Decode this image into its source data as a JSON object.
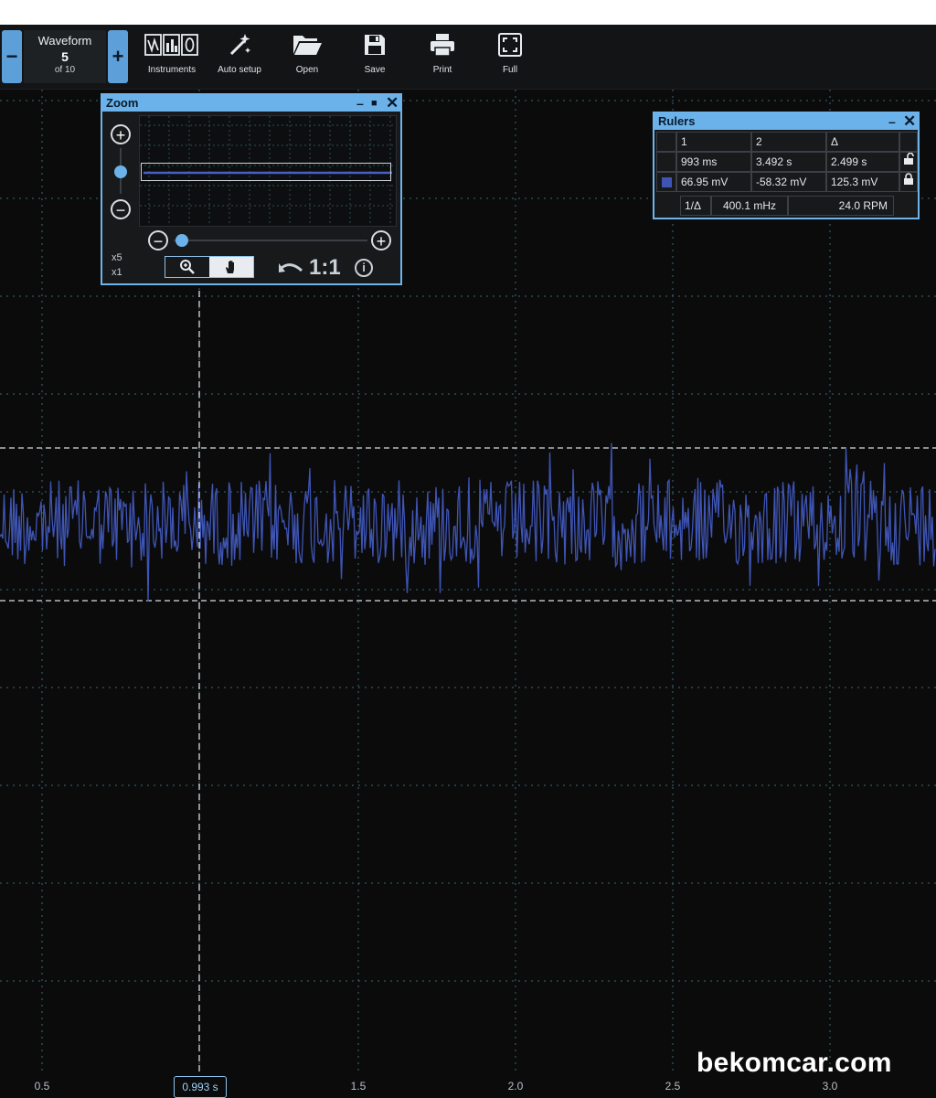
{
  "toolbar": {
    "waveform": {
      "title": "Waveform",
      "current": "5",
      "of": "of 10",
      "minus": "−",
      "plus": "+"
    },
    "buttons": [
      {
        "label": "Instruments",
        "icon": "instruments-icon"
      },
      {
        "label": "Auto setup",
        "icon": "auto-setup-wand-icon"
      },
      {
        "label": "Open",
        "icon": "folder-open-icon"
      },
      {
        "label": "Save",
        "icon": "save-disk-icon"
      },
      {
        "label": "Print",
        "icon": "printer-icon"
      },
      {
        "label": "Full",
        "icon": "fullscreen-icon"
      }
    ]
  },
  "zoom_panel": {
    "title": "Zoom",
    "mag_high": "x5",
    "mag_low": "x1",
    "reset_label": "1:1",
    "info": "i",
    "plus": "+",
    "minus": "−",
    "horizontal_slider_position": 0.0,
    "vertical_slider_position": 0.5
  },
  "rulers_panel": {
    "title": "Rulers",
    "headers": [
      "1",
      "2",
      "Δ"
    ],
    "time_row": [
      "993 ms",
      "3.492 s",
      "2.499 s"
    ],
    "voltage_row": [
      "66.95 mV",
      "-58.32 mV",
      "125.3 mV"
    ],
    "freq_row": {
      "label": "1/Δ",
      "freq": "400.1 mHz",
      "rpm": "24.0 RPM"
    }
  },
  "plot": {
    "x_ticks": [
      "0.5",
      "1.5",
      "2.0",
      "2.5",
      "3.0"
    ],
    "cursor_time": "0.993 s",
    "trace_color": "#3f55b5",
    "grid_color": "#3a6b73",
    "background": "#0b0b0c"
  },
  "watermark": "bekomcar.com",
  "colors": {
    "accent": "#6cb2ea",
    "panel_bg": "#17191b"
  }
}
